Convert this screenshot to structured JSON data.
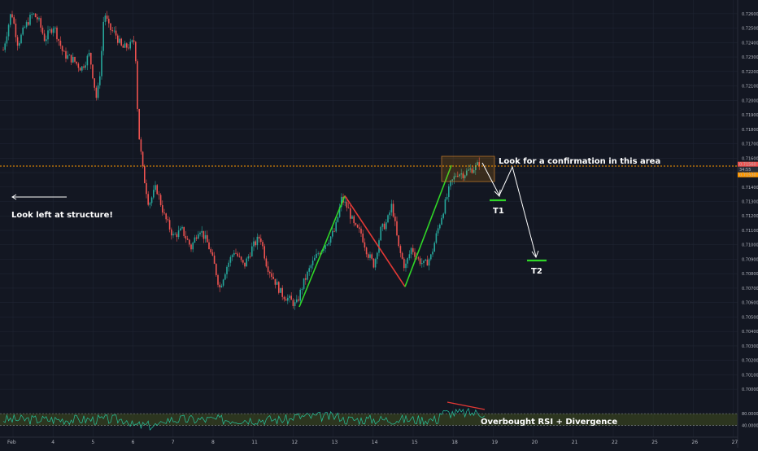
{
  "chart_data": {
    "type": "candlestick",
    "x_ticks": [
      "Feb",
      "4",
      "5",
      "6",
      "7",
      "8",
      "11",
      "12",
      "13",
      "14",
      "15",
      "18",
      "19",
      "20",
      "21",
      "22",
      "25",
      "26",
      "27"
    ],
    "price_ticks": [
      "0.72600",
      "0.72500",
      "0.72400",
      "0.72300",
      "0.72200",
      "0.72100",
      "0.72000",
      "0.71900",
      "0.71800",
      "0.71700",
      "0.71600",
      "0.71500",
      "0.71400",
      "0.71300",
      "0.71200",
      "0.71100",
      "0.71000",
      "0.70900",
      "0.70800",
      "0.70700",
      "0.70600",
      "0.70500",
      "0.70400",
      "0.70300",
      "0.70200",
      "0.70100",
      "0.70000"
    ],
    "ylim": [
      0.6995,
      0.7265
    ],
    "price_labels": {
      "upper": "0.71560",
      "middle": "34:55",
      "lower": "0.71530"
    },
    "horizontal_level": 0.7153,
    "rsi_ticks": [
      "80.0000",
      "40.0000"
    ],
    "rsi_levels": [
      70,
      30
    ],
    "colors": {
      "background": "#131722",
      "up": "#26a69a",
      "down": "#ef5350",
      "grid": "#1f2433",
      "level": "#ff9800",
      "zigzag_up": "#2fd627",
      "zigzag_down": "#e53935",
      "target": "#2fd627",
      "rsi_line": "#26c6a0",
      "rsi_band": "#3d4a1e",
      "divergence": "#e53935"
    },
    "annotations": {
      "confirm": "Look for a confirmation in this area",
      "look_left": "Look left at structure!",
      "t1": "T1",
      "t2": "T2",
      "rsi": "Overbought RSI + Divergence"
    },
    "zigzag": [
      {
        "from": [
          0.7057,
          "Feb 12"
        ],
        "to": [
          0.7134,
          "Feb 13"
        ],
        "direction": "up"
      },
      {
        "from": [
          0.7134,
          "Feb 13"
        ],
        "to": [
          0.7071,
          "Feb 14"
        ],
        "direction": "down"
      },
      {
        "from": [
          0.7071,
          "Feb 14"
        ],
        "to": [
          0.7155,
          "Feb 18"
        ],
        "direction": "up"
      }
    ],
    "targets": {
      "T1": 0.7131,
      "T2": 0.7091
    }
  }
}
